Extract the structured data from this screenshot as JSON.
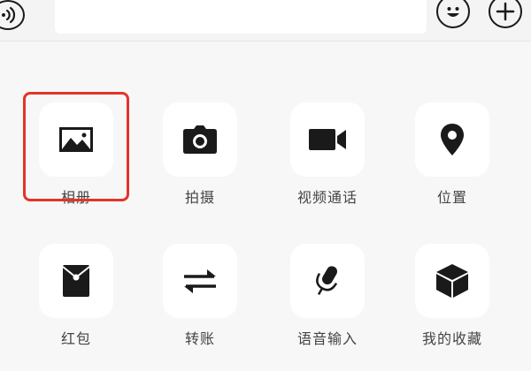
{
  "toolbar": {
    "input_placeholder": ""
  },
  "panel": {
    "items": [
      {
        "label": "相册",
        "icon": "image-icon"
      },
      {
        "label": "拍摄",
        "icon": "camera-icon"
      },
      {
        "label": "视频通话",
        "icon": "video-camera-icon"
      },
      {
        "label": "位置",
        "icon": "location-pin-icon"
      },
      {
        "label": "红包",
        "icon": "red-envelope-icon"
      },
      {
        "label": "转账",
        "icon": "transfer-arrows-icon"
      },
      {
        "label": "语音输入",
        "icon": "microphone-icon"
      },
      {
        "label": "我的收藏",
        "icon": "cube-icon"
      }
    ]
  },
  "colors": {
    "highlight": "#e5332a",
    "icon": "#1a1a1a",
    "tile": "#ffffff",
    "background": "#f7f7f7",
    "label": "#444444"
  }
}
